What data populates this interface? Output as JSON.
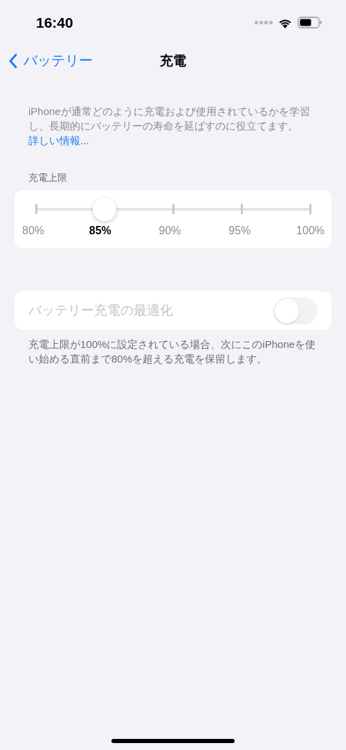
{
  "status_bar": {
    "time": "16:40"
  },
  "nav": {
    "back": "バッテリー",
    "title": "充電"
  },
  "description": {
    "text": "iPhoneが通常どのように充電および使用されているかを学習し、長期的にバッテリーの寿命を延ばすのに役立てます。",
    "link": "詳しい情報..."
  },
  "charge_limit": {
    "header": "充電上限",
    "level": 0.25,
    "stops": [
      {
        "label": "80%",
        "selected": false
      },
      {
        "label": "85%",
        "selected": true
      },
      {
        "label": "90%",
        "selected": false
      },
      {
        "label": "95%",
        "selected": false
      },
      {
        "label": "100%",
        "selected": false
      }
    ]
  },
  "optimization": {
    "label": "バッテリー充電の最適化",
    "on": false,
    "disabled": true,
    "footer": "充電上限が100%に設定されている場合、次にこのiPhoneを使い始める直前まで80%を超える充電を保留します。"
  }
}
